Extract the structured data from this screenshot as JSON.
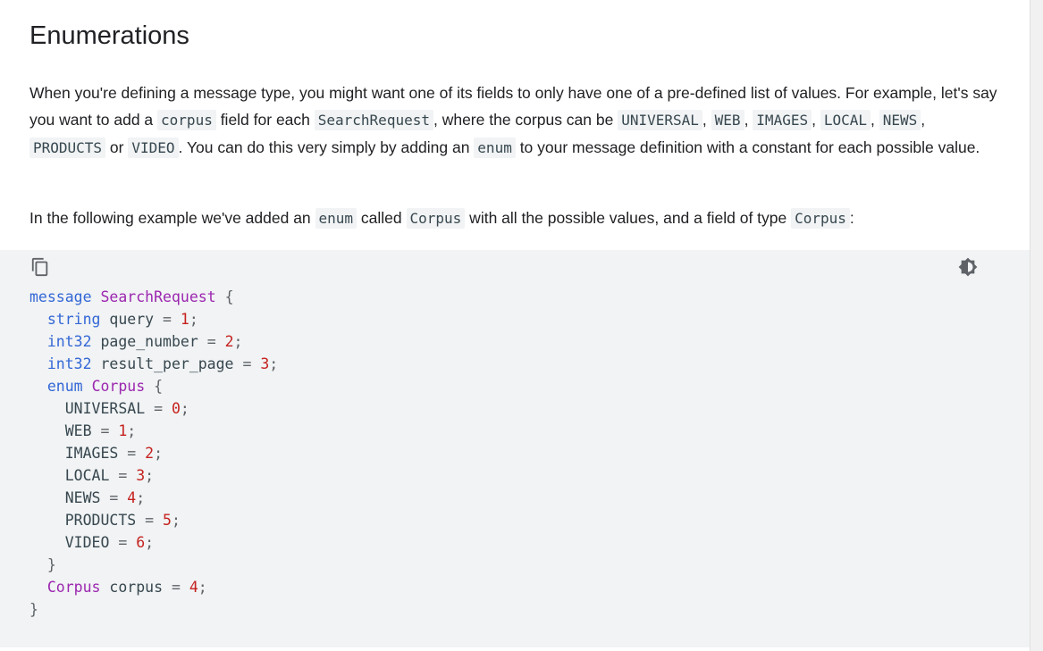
{
  "heading": "Enumerations",
  "paragraph1": {
    "t1": "When you're defining a message type, you might want one of its fields to only have one of a pre-defined list of values. For example, let's say you want to add a ",
    "c1": "corpus",
    "t2": " field for each ",
    "c2": "SearchRequest",
    "t3": ", where the corpus can be ",
    "c3": "UNIVERSAL",
    "t4": ", ",
    "c4": "WEB",
    "t5": ", ",
    "c5": "IMAGES",
    "t6": ", ",
    "c6": "LOCAL",
    "t7": ", ",
    "c7": "NEWS",
    "t8": ", ",
    "c8": "PRODUCTS",
    "t9": " or ",
    "c9": "VIDEO",
    "t10": ". You can do this very simply by adding an ",
    "c10": "enum",
    "t11": " to your message definition with a constant for each possible value."
  },
  "paragraph2": {
    "t1": "In the following example we've added an ",
    "c1": "enum",
    "t2": " called ",
    "c2": "Corpus",
    "t3": " with all the possible values, and a field of type ",
    "c3": "Corpus",
    "t4": ":"
  },
  "code_block": {
    "copy_icon": "copy-icon",
    "theme_icon": "dark-mode-toggle-icon",
    "colors": {
      "background": "#f1f3f4",
      "keyword": "#3367d6",
      "type": "#9c27b0",
      "number": "#c5221f"
    },
    "lines": [
      [
        {
          "t": "message",
          "k": "kw"
        },
        {
          "t": " "
        },
        {
          "t": "SearchRequest",
          "k": "ty"
        },
        {
          "t": " "
        },
        {
          "t": "{",
          "k": "pn"
        }
      ],
      [
        {
          "t": "  "
        },
        {
          "t": "string",
          "k": "kw"
        },
        {
          "t": " query "
        },
        {
          "t": "=",
          "k": "pn"
        },
        {
          "t": " "
        },
        {
          "t": "1",
          "k": "num"
        },
        {
          "t": ";",
          "k": "pn"
        }
      ],
      [
        {
          "t": "  "
        },
        {
          "t": "int32",
          "k": "kw"
        },
        {
          "t": " page_number "
        },
        {
          "t": "=",
          "k": "pn"
        },
        {
          "t": " "
        },
        {
          "t": "2",
          "k": "num"
        },
        {
          "t": ";",
          "k": "pn"
        }
      ],
      [
        {
          "t": "  "
        },
        {
          "t": "int32",
          "k": "kw"
        },
        {
          "t": " result_per_page "
        },
        {
          "t": "=",
          "k": "pn"
        },
        {
          "t": " "
        },
        {
          "t": "3",
          "k": "num"
        },
        {
          "t": ";",
          "k": "pn"
        }
      ],
      [
        {
          "t": "  "
        },
        {
          "t": "enum",
          "k": "kw"
        },
        {
          "t": " "
        },
        {
          "t": "Corpus",
          "k": "ty"
        },
        {
          "t": " "
        },
        {
          "t": "{",
          "k": "pn"
        }
      ],
      [
        {
          "t": "    UNIVERSAL "
        },
        {
          "t": "=",
          "k": "pn"
        },
        {
          "t": " "
        },
        {
          "t": "0",
          "k": "num"
        },
        {
          "t": ";",
          "k": "pn"
        }
      ],
      [
        {
          "t": "    WEB "
        },
        {
          "t": "=",
          "k": "pn"
        },
        {
          "t": " "
        },
        {
          "t": "1",
          "k": "num"
        },
        {
          "t": ";",
          "k": "pn"
        }
      ],
      [
        {
          "t": "    IMAGES "
        },
        {
          "t": "=",
          "k": "pn"
        },
        {
          "t": " "
        },
        {
          "t": "2",
          "k": "num"
        },
        {
          "t": ";",
          "k": "pn"
        }
      ],
      [
        {
          "t": "    LOCAL "
        },
        {
          "t": "=",
          "k": "pn"
        },
        {
          "t": " "
        },
        {
          "t": "3",
          "k": "num"
        },
        {
          "t": ";",
          "k": "pn"
        }
      ],
      [
        {
          "t": "    NEWS "
        },
        {
          "t": "=",
          "k": "pn"
        },
        {
          "t": " "
        },
        {
          "t": "4",
          "k": "num"
        },
        {
          "t": ";",
          "k": "pn"
        }
      ],
      [
        {
          "t": "    PRODUCTS "
        },
        {
          "t": "=",
          "k": "pn"
        },
        {
          "t": " "
        },
        {
          "t": "5",
          "k": "num"
        },
        {
          "t": ";",
          "k": "pn"
        }
      ],
      [
        {
          "t": "    VIDEO "
        },
        {
          "t": "=",
          "k": "pn"
        },
        {
          "t": " "
        },
        {
          "t": "6",
          "k": "num"
        },
        {
          "t": ";",
          "k": "pn"
        }
      ],
      [
        {
          "t": "  "
        },
        {
          "t": "}",
          "k": "pn"
        }
      ],
      [
        {
          "t": "  "
        },
        {
          "t": "Corpus",
          "k": "ty"
        },
        {
          "t": " corpus "
        },
        {
          "t": "=",
          "k": "pn"
        },
        {
          "t": " "
        },
        {
          "t": "4",
          "k": "num"
        },
        {
          "t": ";",
          "k": "pn"
        }
      ],
      [
        {
          "t": "}",
          "k": "pn"
        }
      ]
    ]
  }
}
